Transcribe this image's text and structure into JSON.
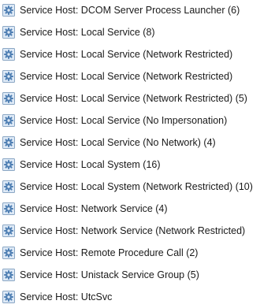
{
  "processes": [
    {
      "label": "Service Host: DCOM Server Process Launcher (6)",
      "icon": "gear-icon"
    },
    {
      "label": "Service Host: Local Service (8)",
      "icon": "gear-icon"
    },
    {
      "label": "Service Host: Local Service (Network Restricted)",
      "icon": "gear-icon"
    },
    {
      "label": "Service Host: Local Service (Network Restricted)",
      "icon": "gear-icon"
    },
    {
      "label": "Service Host: Local Service (Network Restricted) (5)",
      "icon": "gear-icon"
    },
    {
      "label": "Service Host: Local Service (No Impersonation)",
      "icon": "gear-icon"
    },
    {
      "label": "Service Host: Local Service (No Network) (4)",
      "icon": "gear-icon"
    },
    {
      "label": "Service Host: Local System (16)",
      "icon": "gear-icon"
    },
    {
      "label": "Service Host: Local System (Network Restricted) (10)",
      "icon": "gear-icon"
    },
    {
      "label": "Service Host: Network Service (4)",
      "icon": "gear-icon"
    },
    {
      "label": "Service Host: Network Service (Network Restricted)",
      "icon": "gear-icon"
    },
    {
      "label": "Service Host: Remote Procedure Call (2)",
      "icon": "gear-icon"
    },
    {
      "label": "Service Host: Unistack Service Group (5)",
      "icon": "gear-icon"
    },
    {
      "label": "Service Host: UtcSvc",
      "icon": "gear-icon"
    }
  ],
  "colors": {
    "text": "#1a1a1a",
    "icon_frame": "#8aa6c4",
    "icon_fill": "#dde9f6",
    "gear": "#4f7fb3"
  }
}
